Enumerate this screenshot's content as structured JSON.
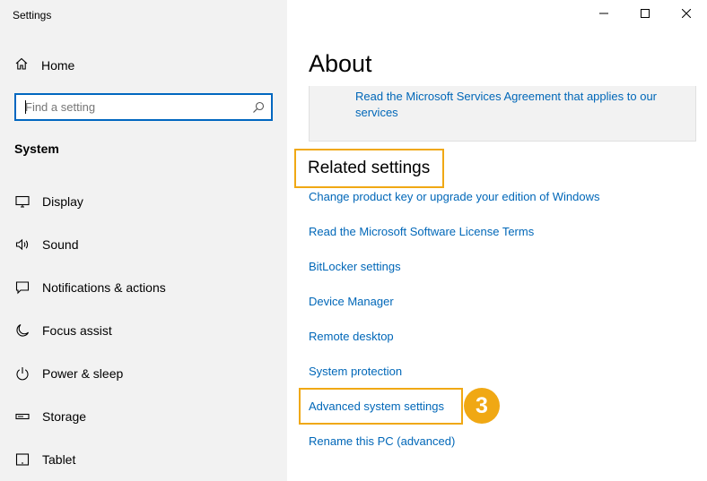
{
  "window": {
    "title": "Settings"
  },
  "sidebar": {
    "home_label": "Home",
    "search": {
      "placeholder": "Find a setting"
    },
    "section_title": "System",
    "items": [
      {
        "label": "Display",
        "icon": "display-icon"
      },
      {
        "label": "Sound",
        "icon": "sound-icon"
      },
      {
        "label": "Notifications & actions",
        "icon": "notifications-icon"
      },
      {
        "label": "Focus assist",
        "icon": "moon-icon"
      },
      {
        "label": "Power & sleep",
        "icon": "power-icon"
      },
      {
        "label": "Storage",
        "icon": "storage-icon"
      },
      {
        "label": "Tablet",
        "icon": "tablet-icon"
      }
    ]
  },
  "main": {
    "title": "About",
    "services_link": "Read the Microsoft Services Agreement that applies to our services",
    "related_title": "Related settings",
    "links": [
      "Change product key or upgrade your edition of Windows",
      "Read the Microsoft Software License Terms",
      "BitLocker settings",
      "Device Manager",
      "Remote desktop",
      "System protection",
      "Advanced system settings",
      "Rename this PC (advanced)"
    ],
    "step_number": "3"
  },
  "colors": {
    "accent": "#0067b8",
    "highlight": "#f0a814",
    "sidebar_bg": "#f2f2f2"
  }
}
